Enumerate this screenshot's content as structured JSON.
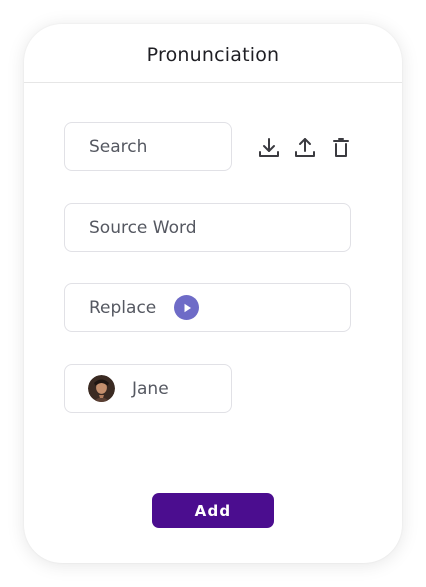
{
  "panel": {
    "title": "Pronunciation"
  },
  "search": {
    "placeholder": "Search"
  },
  "toolbar": {
    "icons": [
      "download-icon",
      "upload-icon",
      "trash-icon"
    ]
  },
  "source_word": {
    "placeholder": "Source Word"
  },
  "replace": {
    "placeholder": "Replace",
    "play_icon": "play-icon"
  },
  "voice": {
    "name": "Jane",
    "avatar_icon": "avatar"
  },
  "add_button": {
    "label": "Add"
  },
  "colors": {
    "accent": "#4b0d8f",
    "play": "#6e6bc7"
  }
}
